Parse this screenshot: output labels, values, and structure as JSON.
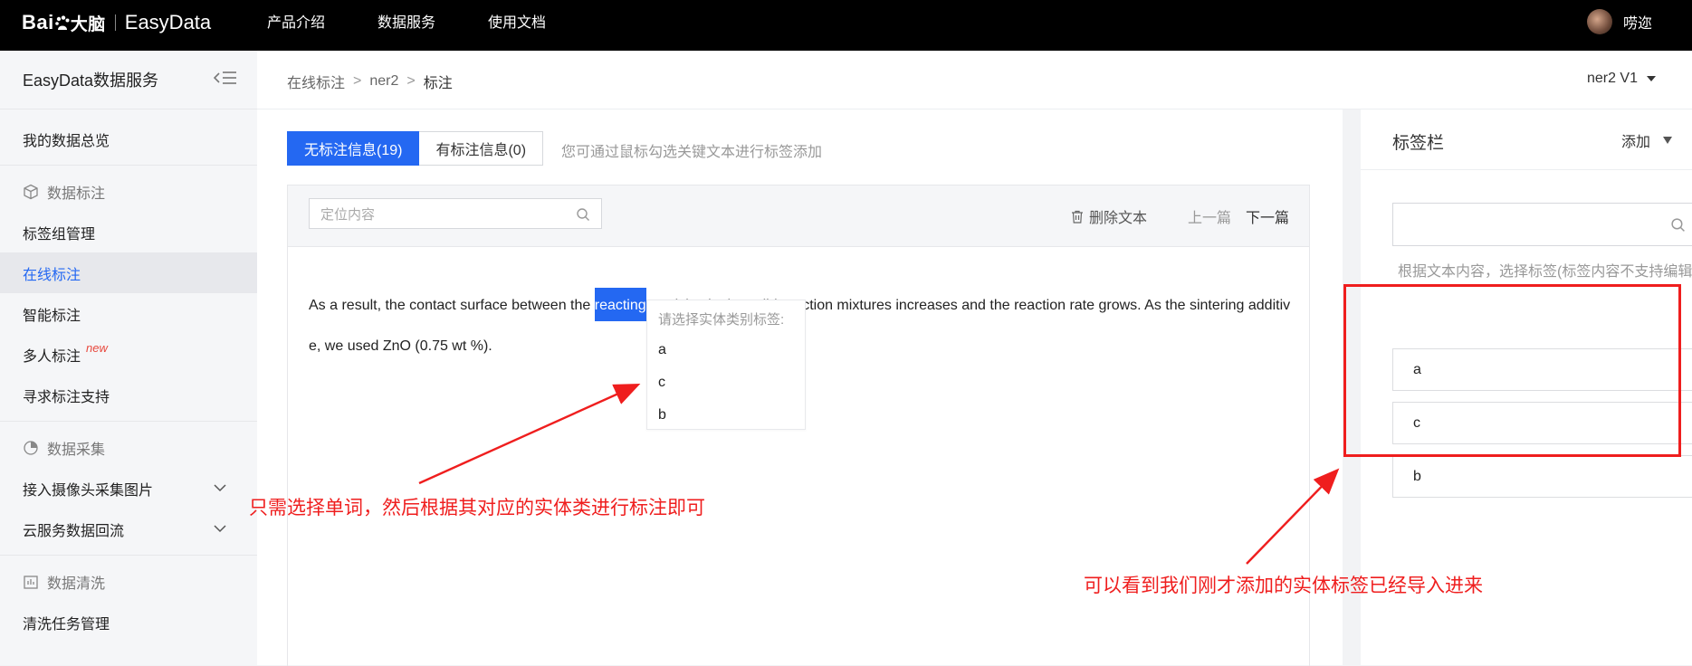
{
  "topbar": {
    "brand": "Bai",
    "brand_cn": "大脑",
    "product": "EasyData",
    "nav": [
      "产品介绍",
      "数据服务",
      "使用文档"
    ],
    "user": "唠迩"
  },
  "sidebar": {
    "title": "EasyData数据服务",
    "overview": "我的数据总览",
    "section_labeling": "数据标注",
    "tag_group": "标签组管理",
    "online_label": "在线标注",
    "smart_label": "智能标注",
    "multi_label": "多人标注",
    "new_badge": "new",
    "seek_support": "寻求标注支持",
    "section_collect": "数据采集",
    "camera": "接入摄像头采集图片",
    "cloud": "云服务数据回流",
    "section_clean": "数据清洗",
    "clean_task": "清洗任务管理"
  },
  "breadcrumb": {
    "items": [
      "在线标注",
      "ner2",
      "标注"
    ],
    "version": "ner2 V1"
  },
  "tabs": {
    "unlabeled": "无标注信息(19)",
    "labeled": "有标注信息(0)",
    "hint": "您可通过鼠标勾选关键文本进行标签添加"
  },
  "toolbar": {
    "search_placeholder": "定位内容",
    "delete": "删除文本",
    "prev": "上一篇",
    "next": "下一篇"
  },
  "text": {
    "before": "As a result, the contact surface between the ",
    "highlight": "reacting",
    "after": " particles in the solid reaction mixtures increases and the reaction rate grows. As the sintering additive, we used ZnO (0.75 wt %)."
  },
  "popup": {
    "prompt": "请选择实体类别标签:",
    "options": [
      "a",
      "c",
      "b"
    ]
  },
  "right": {
    "title": "标签栏",
    "add": "添加",
    "search_placeholder": "",
    "hint": "根据文本内容，选择标签(标签内容不支持编辑)",
    "labels": [
      "a",
      "c",
      "b"
    ]
  },
  "annotations": {
    "left": "只需选择单词，然后根据其对应的实体类进行标注即可",
    "right": "可以看到我们刚才添加的实体标签已经导入进来",
    "color": "#ef1e1e"
  }
}
